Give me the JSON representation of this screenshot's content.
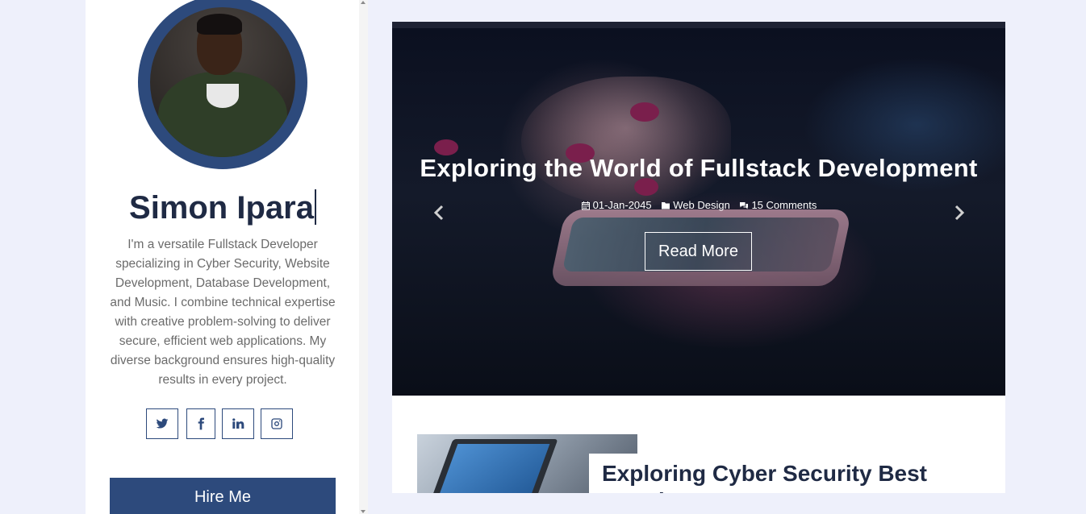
{
  "profile": {
    "name": "Simon Ipara",
    "bio": "I'm a versatile Fullstack Developer specializing in Cyber Security, Website Development, Database Development, and Music. I combine technical expertise with creative problem-solving to deliver secure, efficient web applications. My diverse background ensures high-quality results in every project.",
    "hire_label": "Hire Me",
    "socials": [
      {
        "name": "twitter",
        "icon": "twitter-icon"
      },
      {
        "name": "facebook",
        "icon": "facebook-icon"
      },
      {
        "name": "linkedin",
        "icon": "linkedin-icon"
      },
      {
        "name": "instagram",
        "icon": "instagram-icon"
      }
    ]
  },
  "carousel": {
    "title": "Exploring the World of Fullstack Development",
    "date": "01-Jan-2045",
    "category": "Web Design",
    "comments": "15 Comments",
    "read_more": "Read More"
  },
  "posts": [
    {
      "title": "Exploring Cyber Security Best Practices"
    }
  ],
  "colors": {
    "accent": "#2d4a7c",
    "heading": "#1f2a44",
    "page_bg": "#eef0fb"
  }
}
